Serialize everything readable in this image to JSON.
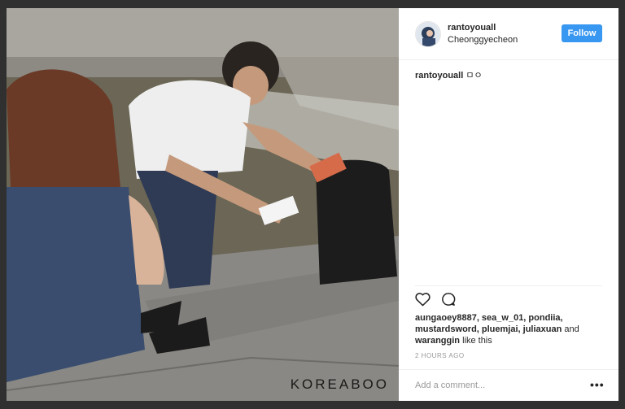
{
  "photo": {
    "watermark": "KOREABOO"
  },
  "post": {
    "username": "rantoyouall",
    "location": "Cheonggyecheon",
    "follow_label": "Follow",
    "caption_user": "rantoyouall",
    "caption_text": " ㅁㅇ"
  },
  "likes": {
    "names": "aungaoey8887, sea_w_01, pondiia, mustardsword, pluemjai, juliaxuan",
    "joiner": " and ",
    "last_name": "waranggin",
    "suffix": " like this"
  },
  "timestamp": "2 HOURS AGO",
  "comment": {
    "placeholder": "Add a comment..."
  },
  "more_label": "•••",
  "colors": {
    "follow_bg": "#3897f0",
    "text": "#262626",
    "muted": "#999999"
  },
  "icons": [
    "heart-icon",
    "comment-icon",
    "more-icon"
  ]
}
